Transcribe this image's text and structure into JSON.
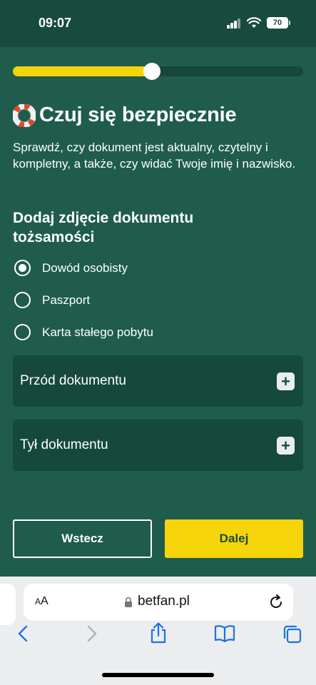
{
  "status_bar": {
    "time": "09:07",
    "battery": "70"
  },
  "progress": {
    "fraction": 0.48
  },
  "intro": {
    "title": "Czuj się bezpiecznie",
    "description": "Sprawdź, czy dokument jest aktualny, czytelny i kompletny, a także, czy widać Twoje imię i nazwisko."
  },
  "document_section": {
    "title": "Dodaj zdjęcie dokumentu tożsamości",
    "options": [
      {
        "label": "Dowód osobisty",
        "selected": true
      },
      {
        "label": "Paszport",
        "selected": false
      },
      {
        "label": "Karta stałego pobytu",
        "selected": false
      }
    ],
    "uploads": [
      {
        "label": "Przód dokumentu",
        "action": "+"
      },
      {
        "label": "Tył dokumentu",
        "action": "+"
      }
    ]
  },
  "buttons": {
    "back": "Wstecz",
    "next": "Dalej"
  },
  "browser": {
    "aa_large": "A",
    "aa_small": "A",
    "url": "betfan.pl"
  },
  "colors": {
    "background": "#1f5c4c",
    "card": "#15493b",
    "accent": "#f5d50a",
    "text": "#ffffff"
  },
  "icons": [
    "signal-icon",
    "wifi-icon",
    "battery-icon",
    "lifebuoy-icon",
    "plus-icon",
    "lock-icon",
    "reload-icon",
    "back-arrow-icon",
    "forward-arrow-icon",
    "share-icon",
    "bookmarks-icon",
    "tabs-icon"
  ]
}
